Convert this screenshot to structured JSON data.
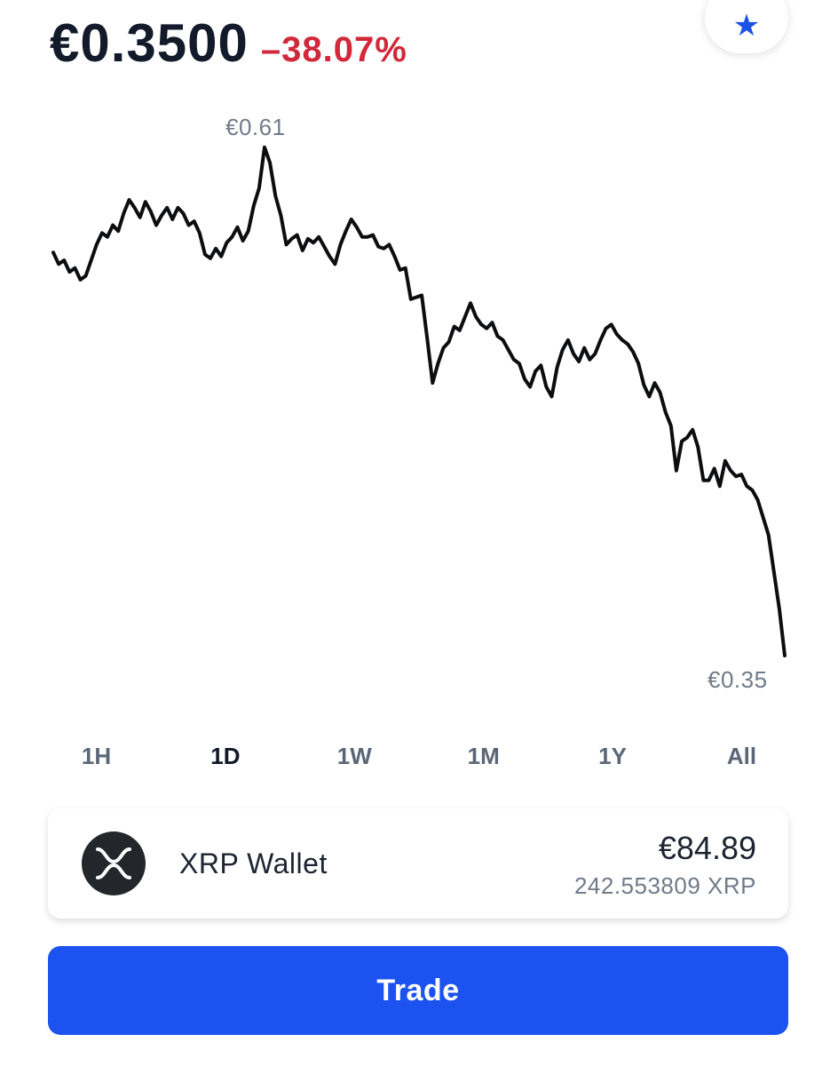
{
  "header": {
    "price": "€0.3500",
    "change": "–38.07%",
    "favorite_icon": "star-icon",
    "colors": {
      "change": "#d2283a",
      "favorite": "#1c52e6"
    }
  },
  "chart": {
    "high_label": "€0.61",
    "low_label": "€0.35"
  },
  "chart_data": {
    "type": "line",
    "ylim": [
      0.35,
      0.61
    ],
    "series": [
      {
        "values": [
          0.557,
          0.551,
          0.553,
          0.547,
          0.549,
          0.543,
          0.545,
          0.553,
          0.561,
          0.567,
          0.565,
          0.571,
          0.568,
          0.577,
          0.584,
          0.58,
          0.575,
          0.583,
          0.578,
          0.571,
          0.576,
          0.58,
          0.574,
          0.58,
          0.577,
          0.571,
          0.573,
          0.567,
          0.556,
          0.554,
          0.559,
          0.555,
          0.562,
          0.565,
          0.57,
          0.563,
          0.568,
          0.581,
          0.59,
          0.611,
          0.603,
          0.586,
          0.576,
          0.561,
          0.564,
          0.566,
          0.558,
          0.564,
          0.562,
          0.565,
          0.56,
          0.555,
          0.551,
          0.561,
          0.568,
          0.574,
          0.57,
          0.565,
          0.565,
          0.566,
          0.56,
          0.559,
          0.561,
          0.555,
          0.548,
          0.549,
          0.533,
          0.534,
          0.535,
          0.513,
          0.49,
          0.5,
          0.508,
          0.511,
          0.519,
          0.517,
          0.524,
          0.531,
          0.524,
          0.52,
          0.518,
          0.521,
          0.514,
          0.512,
          0.507,
          0.502,
          0.5,
          0.492,
          0.488,
          0.496,
          0.499,
          0.488,
          0.483,
          0.498,
          0.507,
          0.512,
          0.505,
          0.501,
          0.508,
          0.502,
          0.505,
          0.512,
          0.518,
          0.52,
          0.515,
          0.512,
          0.51,
          0.506,
          0.5,
          0.489,
          0.483,
          0.49,
          0.485,
          0.475,
          0.468,
          0.445,
          0.46,
          0.462,
          0.466,
          0.457,
          0.44,
          0.44,
          0.446,
          0.437,
          0.45,
          0.445,
          0.442,
          0.443,
          0.437,
          0.435,
          0.43,
          0.421,
          0.412,
          0.393,
          0.374,
          0.35
        ]
      }
    ],
    "grid": false
  },
  "range_tabs": {
    "selected": "1D",
    "items": [
      {
        "label": "1H"
      },
      {
        "label": "1D"
      },
      {
        "label": "1W"
      },
      {
        "label": "1M"
      },
      {
        "label": "1Y"
      },
      {
        "label": "All"
      }
    ]
  },
  "wallet": {
    "icon": "xrp-logo-icon",
    "name": "XRP Wallet",
    "fiat_balance": "€84.89",
    "crypto_balance": "242.553809 XRP"
  },
  "trade_button": {
    "label": "Trade",
    "color": "#1c52f0"
  }
}
